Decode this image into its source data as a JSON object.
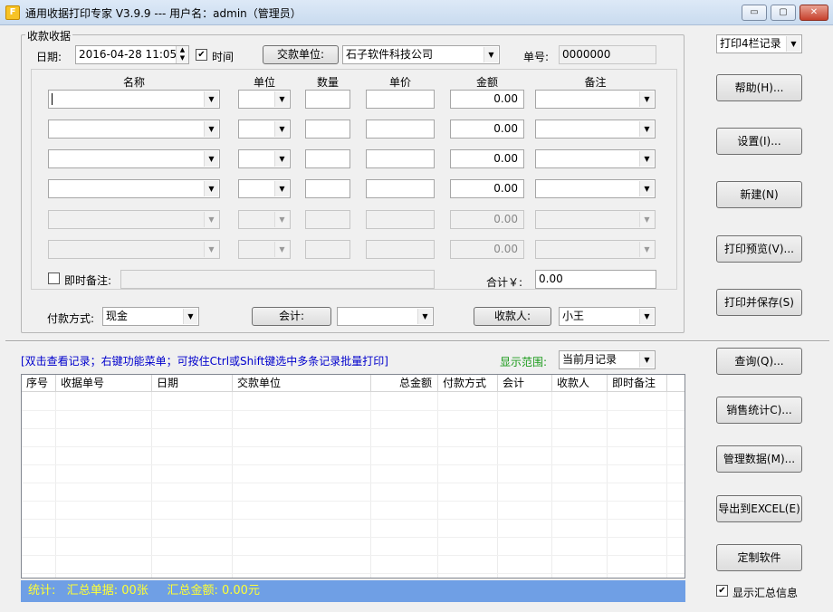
{
  "window": {
    "icon_letter": "F",
    "title": "通用收据打印专家 V3.9.9 --- 用户名：admin（管理员）",
    "controls": {
      "minimize": "▭",
      "maximize": "▢",
      "close": "✕"
    }
  },
  "receipt": {
    "group_label": "收款收据",
    "date_label": "日期:",
    "date_value": "2016-04-28 11:05:",
    "time_checked": true,
    "time_label": "时间",
    "payer_label": "交款单位:",
    "payer_value": "石子软件科技公司",
    "number_label": "单号:",
    "number_value": "0000000",
    "columns": {
      "name": "名称",
      "unit": "单位",
      "qty": "数量",
      "price": "单价",
      "amount": "金额",
      "note": "备注"
    },
    "rows": [
      {
        "name": "",
        "unit": "",
        "qty": "",
        "price": "",
        "amount": "0.00",
        "note": "",
        "enabled": true
      },
      {
        "name": "",
        "unit": "",
        "qty": "",
        "price": "",
        "amount": "0.00",
        "note": "",
        "enabled": true
      },
      {
        "name": "",
        "unit": "",
        "qty": "",
        "price": "",
        "amount": "0.00",
        "note": "",
        "enabled": true
      },
      {
        "name": "",
        "unit": "",
        "qty": "",
        "price": "",
        "amount": "0.00",
        "note": "",
        "enabled": true
      },
      {
        "name": "",
        "unit": "",
        "qty": "",
        "price": "",
        "amount": "0.00",
        "note": "",
        "enabled": false
      },
      {
        "name": "",
        "unit": "",
        "qty": "",
        "price": "",
        "amount": "0.00",
        "note": "",
        "enabled": false
      }
    ],
    "instant_note_checked": false,
    "instant_note_label": "即时备注:",
    "instant_note_value": "",
    "total_label": "合计￥:",
    "total_value": "0.00",
    "payment_label": "付款方式:",
    "payment_value": "现金",
    "accountant_label": "会计:",
    "accountant_value": "",
    "payee_label": "收款人:",
    "payee_value": "小王"
  },
  "right_panel": {
    "print_mode_value": "打印4栏记录",
    "help": "帮助(H)...",
    "settings": "设置(I)...",
    "new": "新建(N)",
    "print_preview": "打印预览(V)...",
    "print_save": "打印并保存(S)",
    "query": "查询(Q)...",
    "sales_stats": "销售统计C)...",
    "manage_data": "管理数据(M)...",
    "export_excel": "导出到EXCEL(E)",
    "custom_software": "定制软件",
    "show_summary_checked": true,
    "show_summary_label": "显示汇总信息"
  },
  "records": {
    "hint": "[双击查看记录；右键功能菜单；可按住Ctrl或Shift键选中多条记录批量打印]",
    "range_label": "显示范围:",
    "range_value": "当前月记录",
    "columns": [
      "序号",
      "收据单号",
      "日期",
      "交款单位",
      "总金额",
      "付款方式",
      "会计",
      "收款人",
      "即时备注"
    ],
    "rows": []
  },
  "status": {
    "text": "统计:   汇总单据: 00张     汇总金额: 0.00元"
  },
  "colors": {
    "hint_blue": "#0000cc",
    "range_green": "#1a9a1a",
    "status_bg": "#6f9fe5",
    "status_text": "#ffff33"
  }
}
